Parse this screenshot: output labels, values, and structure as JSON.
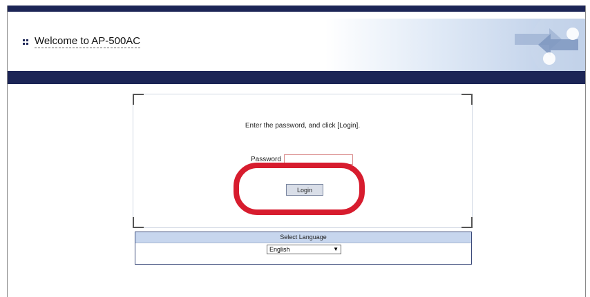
{
  "header": {
    "title": "Welcome to AP-500AC"
  },
  "login": {
    "instruction": "Enter the password, and click [Login].",
    "password_label": "Password",
    "password_value": "",
    "login_label": "Login"
  },
  "language": {
    "title": "Select Language",
    "selected": "English"
  },
  "colors": {
    "nav_bar": "#1c2556",
    "highlight": "#d71c2e",
    "lang_header": "#c7d6ee"
  }
}
